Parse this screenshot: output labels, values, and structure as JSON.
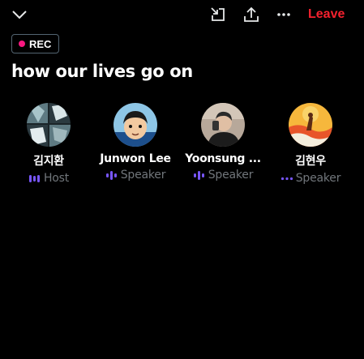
{
  "header": {
    "leave_label": "Leave",
    "icons": [
      "chevron-down-icon",
      "minimize-icon",
      "share-icon",
      "more-icon"
    ]
  },
  "recording": {
    "label": "REC",
    "dot_color": "#f91880"
  },
  "space": {
    "title": "how our lives go on"
  },
  "speakers": [
    {
      "name": "김지환",
      "role": "Host",
      "indicator": "audio-bars-icon"
    },
    {
      "name": "Junwon Lee",
      "role": "Speaker",
      "indicator": "audio-bars-icon"
    },
    {
      "name": "Yoonsung ...",
      "role": "Speaker",
      "indicator": "audio-bars-icon"
    },
    {
      "name": "김현우",
      "role": "Speaker",
      "indicator": "dots-icon"
    }
  ],
  "colors": {
    "leave": "#f4212e",
    "audio_indicator": "#7856ff",
    "role_text": "#71767b",
    "background": "#000000"
  }
}
